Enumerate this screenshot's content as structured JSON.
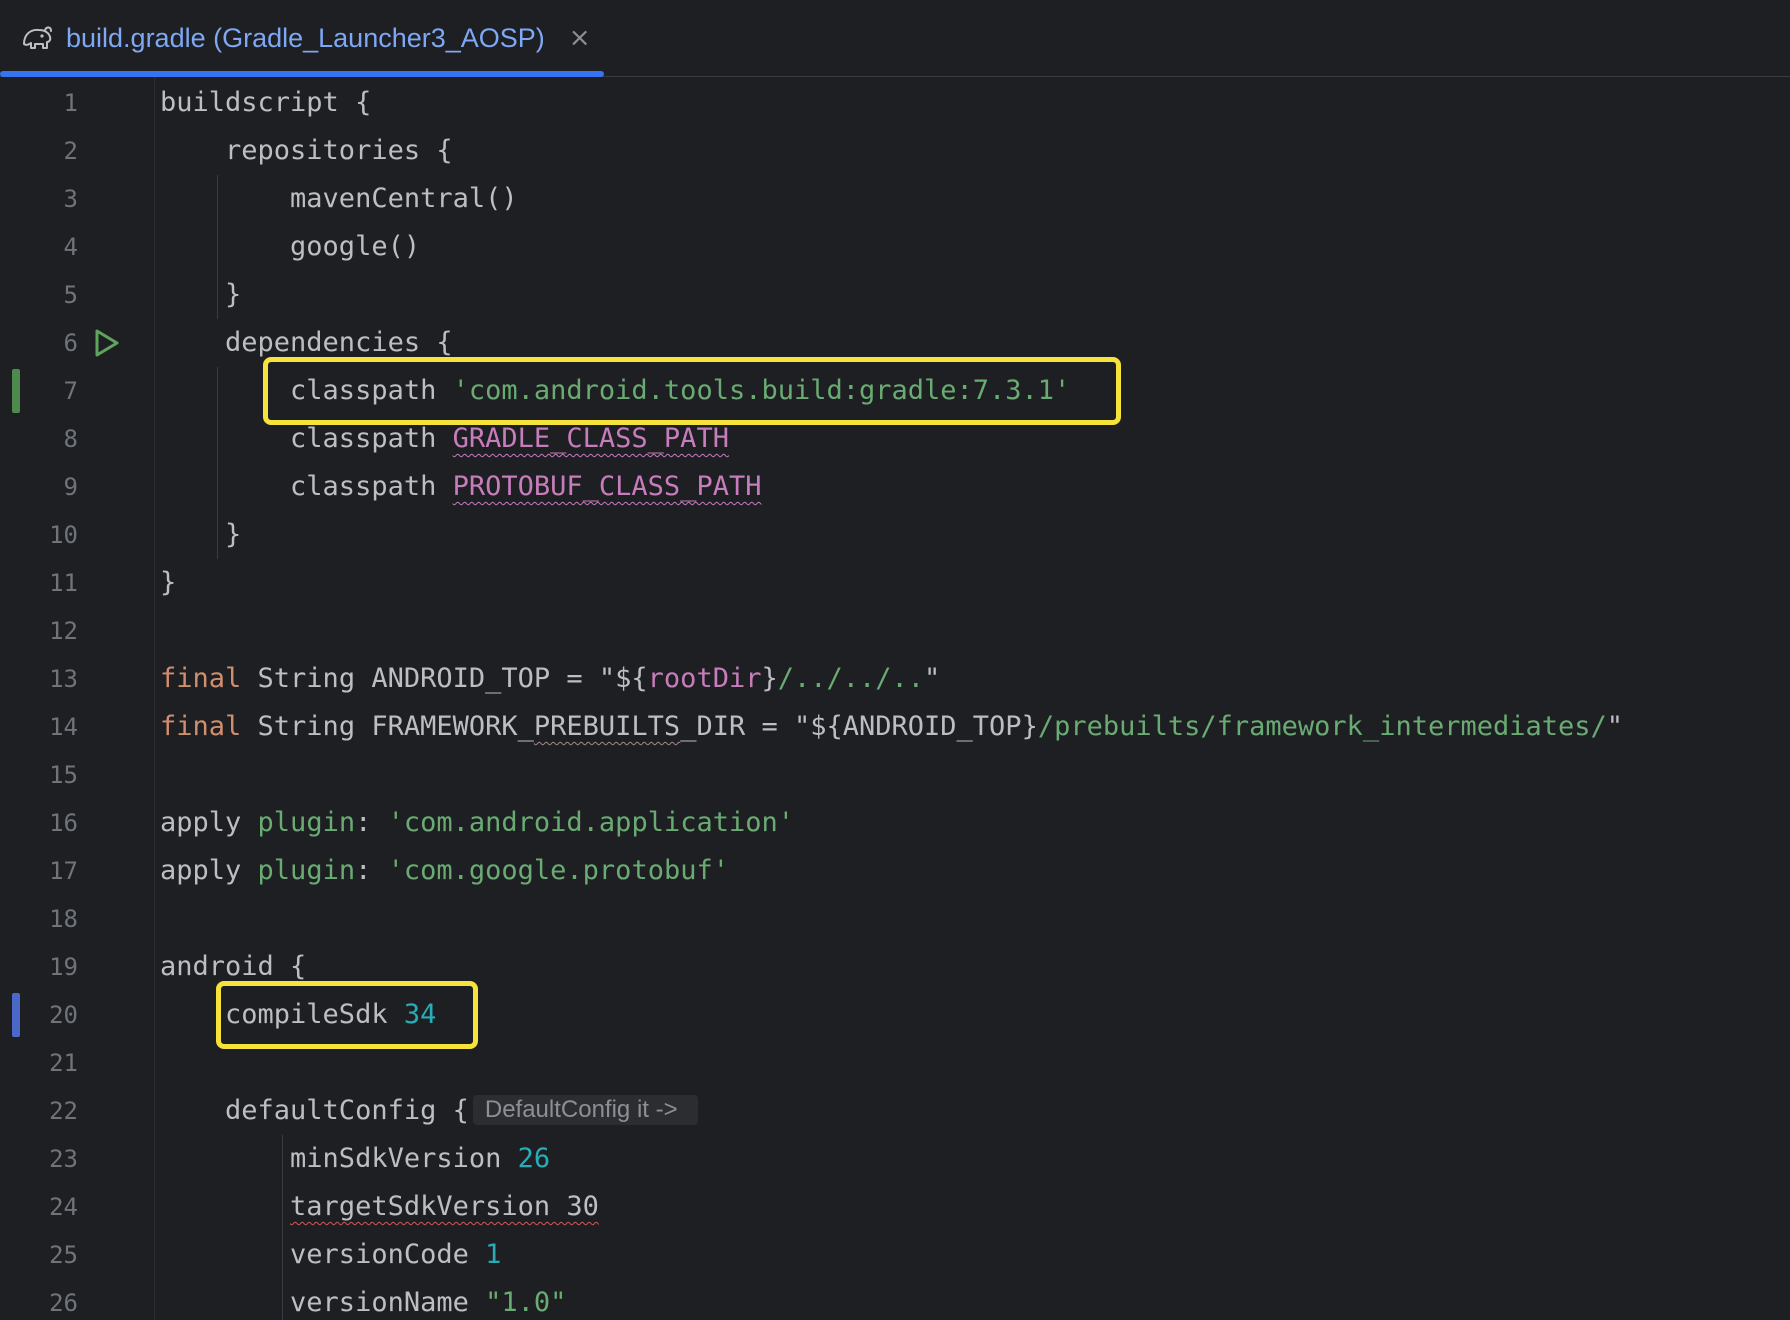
{
  "tab": {
    "icon": "gradle-elephant-icon",
    "title": "build.gradle (Gradle_Launcher3_AOSP)",
    "close_glyph": "×"
  },
  "colors": {
    "accent": "#3574f0",
    "highlight": "#f5e23a",
    "keyword": "#cf8e6d",
    "string": "#6aab73",
    "number": "#2aacb8",
    "field": "#c77dbb",
    "run_icon": "#5fa35f",
    "change_added": "#4e8a4e",
    "change_modified": "#4b67c7"
  },
  "lines": [
    {
      "n": "1",
      "tokens": [
        {
          "t": "buildscript {",
          "c": ""
        }
      ]
    },
    {
      "n": "2",
      "tokens": [
        {
          "t": "    repositories {",
          "c": ""
        }
      ]
    },
    {
      "n": "3",
      "tokens": [
        {
          "t": "        mavenCentral()",
          "c": ""
        }
      ]
    },
    {
      "n": "4",
      "tokens": [
        {
          "t": "        google()",
          "c": ""
        }
      ]
    },
    {
      "n": "5",
      "tokens": [
        {
          "t": "    }",
          "c": ""
        }
      ]
    },
    {
      "n": "6",
      "tokens": [
        {
          "t": "    dependencies {",
          "c": ""
        }
      ]
    },
    {
      "n": "7",
      "tokens": [
        {
          "t": "        classpath ",
          "c": ""
        },
        {
          "t": "'com.android.tools.build:gradle:7.3.1'",
          "c": "str"
        }
      ]
    },
    {
      "n": "8",
      "tokens": [
        {
          "t": "        classpath ",
          "c": ""
        },
        {
          "t": "GRADLE_CLASS_PATH",
          "c": "fld warn"
        }
      ]
    },
    {
      "n": "9",
      "tokens": [
        {
          "t": "        classpath ",
          "c": ""
        },
        {
          "t": "PROTOBUF_CLASS_PATH",
          "c": "fld warn"
        }
      ]
    },
    {
      "n": "10",
      "tokens": [
        {
          "t": "    }",
          "c": ""
        }
      ]
    },
    {
      "n": "11",
      "tokens": [
        {
          "t": "}",
          "c": ""
        }
      ]
    },
    {
      "n": "12",
      "tokens": []
    },
    {
      "n": "13",
      "tokens": [
        {
          "t": "final",
          "c": "kw"
        },
        {
          "t": " String ANDROID_TOP = \"${",
          "c": ""
        },
        {
          "t": "rootDir",
          "c": "fld"
        },
        {
          "t": "}",
          "c": ""
        },
        {
          "t": "/../../..",
          "c": "str"
        },
        {
          "t": "\"",
          "c": ""
        }
      ]
    },
    {
      "n": "14",
      "tokens": [
        {
          "t": "final",
          "c": "kw"
        },
        {
          "t": " String FRAMEWORK_",
          "c": ""
        },
        {
          "t": "PREBUILTS",
          "c": "typo"
        },
        {
          "t": "_DIR = \"${ANDROID_TOP}",
          "c": ""
        },
        {
          "t": "/prebuilts/framework_intermediates/",
          "c": "str"
        },
        {
          "t": "\"",
          "c": ""
        }
      ]
    },
    {
      "n": "15",
      "tokens": []
    },
    {
      "n": "16",
      "tokens": [
        {
          "t": "apply ",
          "c": ""
        },
        {
          "t": "plugin",
          "c": "str"
        },
        {
          "t": ": ",
          "c": ""
        },
        {
          "t": "'com.android.application'",
          "c": "str"
        }
      ]
    },
    {
      "n": "17",
      "tokens": [
        {
          "t": "apply ",
          "c": ""
        },
        {
          "t": "plugin",
          "c": "str"
        },
        {
          "t": ": ",
          "c": ""
        },
        {
          "t": "'com.google.protobuf'",
          "c": "str"
        }
      ]
    },
    {
      "n": "18",
      "tokens": []
    },
    {
      "n": "19",
      "tokens": [
        {
          "t": "android {",
          "c": ""
        }
      ]
    },
    {
      "n": "20",
      "tokens": [
        {
          "t": "    compileSdk ",
          "c": ""
        },
        {
          "t": "34",
          "c": "num"
        }
      ]
    },
    {
      "n": "21",
      "tokens": []
    },
    {
      "n": "22",
      "tokens": [
        {
          "t": "    defaultConfig {",
          "c": ""
        }
      ],
      "hint": "DefaultConfig it ->"
    },
    {
      "n": "23",
      "tokens": [
        {
          "t": "        minSdkVersion ",
          "c": ""
        },
        {
          "t": "26",
          "c": "num"
        }
      ]
    },
    {
      "n": "24",
      "tokens": [
        {
          "t": "        ",
          "c": ""
        },
        {
          "t": "targetSdkVersion 30",
          "c": "err"
        }
      ]
    },
    {
      "n": "25",
      "tokens": [
        {
          "t": "        versionCode ",
          "c": ""
        },
        {
          "t": "1",
          "c": "num"
        }
      ]
    },
    {
      "n": "26",
      "tokens": [
        {
          "t": "        versionName ",
          "c": ""
        },
        {
          "t": "\"1.0\"",
          "c": "str"
        }
      ]
    }
  ]
}
